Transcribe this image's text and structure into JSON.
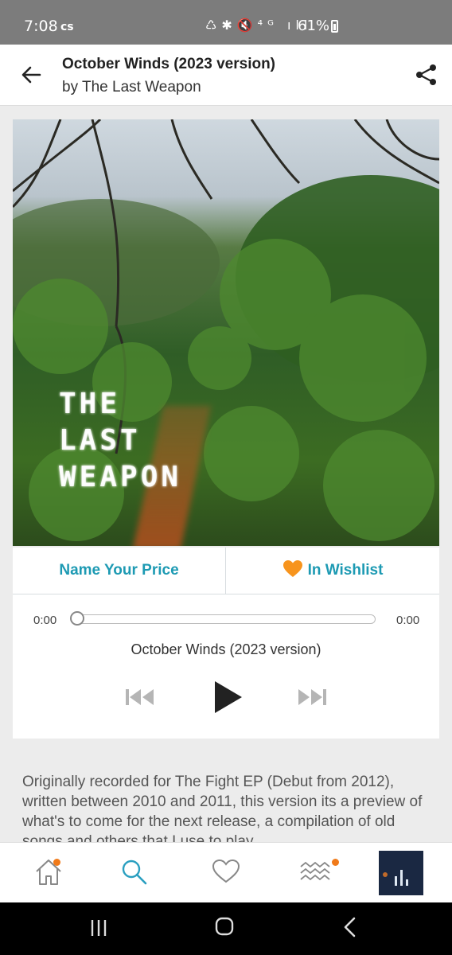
{
  "status_bar": {
    "time": "7:08",
    "carrier_badge": "cs",
    "battery": "61%",
    "icons": [
      "recycle-icon",
      "bluetooth-icon",
      "mute-icon",
      "4g-icon",
      "signal-icon"
    ]
  },
  "header": {
    "title": "October Winds (2023 version)",
    "artist": "by The Last Weapon"
  },
  "artwork": {
    "logo_text": "THE LAST WEAPON"
  },
  "purchase": {
    "name_price_label": "Name Your Price",
    "wishlist_label": "In Wishlist",
    "accent_color": "#1d9ab3",
    "heart_color": "#f7941d"
  },
  "player": {
    "elapsed": "0:00",
    "duration": "0:00",
    "progress": 0,
    "track_title": "October Winds (2023 version)"
  },
  "description": "Originally recorded for The Fight EP (Debut from 2012), written between 2010 and 2011, this version its a preview of what's to come for the next release, a compilation of old songs and others that I use to play",
  "bottom_nav": {
    "items": [
      "home",
      "search",
      "wishlist",
      "feed",
      "now-playing"
    ]
  }
}
